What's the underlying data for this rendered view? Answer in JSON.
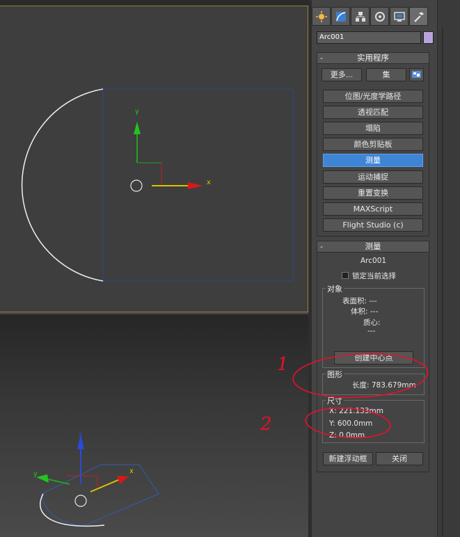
{
  "object_name": "Arc001",
  "colors": {
    "object_color": "#b9a3de",
    "active_button": "#3f85d6",
    "annotation": "#e8112b",
    "arc_white": "#f0f0f0",
    "bbox_blue": "#2b4a8a"
  },
  "tabs": [
    "create-icon",
    "modify-icon",
    "hierarchy-icon",
    "motion-icon",
    "display-icon",
    "utilities-icon"
  ],
  "utilities": {
    "title": "实用程序",
    "more_label": "更多...",
    "sets_label": "集",
    "buttons": [
      "位图/光度学路径",
      "透视匹配",
      "塌陷",
      "颜色剪贴板",
      "测量",
      "运动捕捉",
      "重置变换",
      "MAXScript",
      "Flight Studio (c)"
    ],
    "active_index": 4
  },
  "measure": {
    "title": "测量",
    "object_label": "Arc001",
    "lock_label": "锁定当前选择",
    "objects_group": "对象",
    "surface_area": "表面积: ---",
    "volume": "体积: ---",
    "center_mass": "质心:",
    "center_mass_value": "---",
    "create_center_btn": "创建中心点",
    "shapes_group": "图形",
    "length": "长度: 783.679mm",
    "dimensions_group": "尺寸",
    "x": "X:  221.133mm",
    "y": "Y:  600.0mm",
    "z": "Z:  0.0mm",
    "new_float_btn": "新建浮动框",
    "close_btn": "关闭"
  },
  "annotations": {
    "one": "1",
    "two": "2"
  },
  "axis_labels": {
    "x": "x",
    "y": "y",
    "z": "z"
  }
}
